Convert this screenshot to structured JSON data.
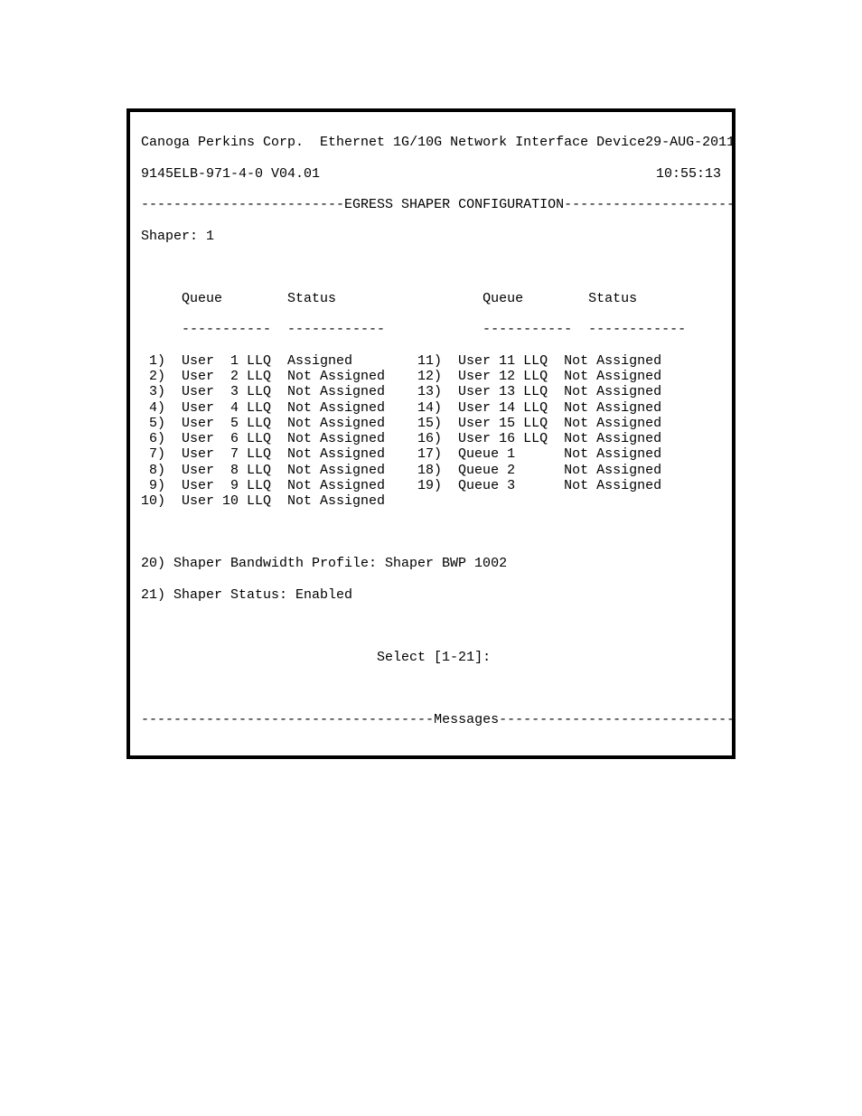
{
  "header": {
    "company": "Canoga Perkins Corp.",
    "device": "Ethernet 1G/10G Network Interface Device",
    "date": "29-AUG-2011",
    "model": "9145ELB-971-4-0 V04.01",
    "time": "10:55:13"
  },
  "section_title": "EGRESS SHAPER CONFIGURATION",
  "shaper_label": "Shaper: 1",
  "col": {
    "queue": "Queue",
    "status": "Status"
  },
  "rows": [
    {
      "idx": " 1)",
      "q": "User  1 LLQ",
      "s": "Assigned",
      "idx2": "11)",
      "q2": "User 11 LLQ",
      "s2": "Not Assigned"
    },
    {
      "idx": " 2)",
      "q": "User  2 LLQ",
      "s": "Not Assigned",
      "idx2": "12)",
      "q2": "User 12 LLQ",
      "s2": "Not Assigned"
    },
    {
      "idx": " 3)",
      "q": "User  3 LLQ",
      "s": "Not Assigned",
      "idx2": "13)",
      "q2": "User 13 LLQ",
      "s2": "Not Assigned"
    },
    {
      "idx": " 4)",
      "q": "User  4 LLQ",
      "s": "Not Assigned",
      "idx2": "14)",
      "q2": "User 14 LLQ",
      "s2": "Not Assigned"
    },
    {
      "idx": " 5)",
      "q": "User  5 LLQ",
      "s": "Not Assigned",
      "idx2": "15)",
      "q2": "User 15 LLQ",
      "s2": "Not Assigned"
    },
    {
      "idx": " 6)",
      "q": "User  6 LLQ",
      "s": "Not Assigned",
      "idx2": "16)",
      "q2": "User 16 LLQ",
      "s2": "Not Assigned"
    },
    {
      "idx": " 7)",
      "q": "User  7 LLQ",
      "s": "Not Assigned",
      "idx2": "17)",
      "q2": "Queue 1    ",
      "s2": "Not Assigned"
    },
    {
      "idx": " 8)",
      "q": "User  8 LLQ",
      "s": "Not Assigned",
      "idx2": "18)",
      "q2": "Queue 2    ",
      "s2": "Not Assigned"
    },
    {
      "idx": " 9)",
      "q": "User  9 LLQ",
      "s": "Not Assigned",
      "idx2": "19)",
      "q2": "Queue 3    ",
      "s2": "Not Assigned"
    },
    {
      "idx": "10)",
      "q": "User 10 LLQ",
      "s": "Not Assigned",
      "idx2": "   ",
      "q2": "           ",
      "s2": ""
    }
  ],
  "opt20": "20) Shaper Bandwidth Profile: Shaper BWP 1002",
  "opt21": "21) Shaper Status: Enabled",
  "prompt": "Select [1-21]:",
  "messages_label": "Messages"
}
